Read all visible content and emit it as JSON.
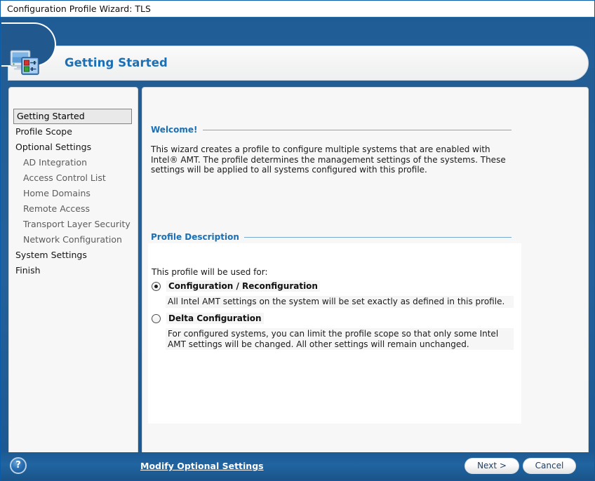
{
  "window": {
    "title": "Configuration Profile Wizard: TLS"
  },
  "header": {
    "icon": "amt-configuration-icon",
    "title": "Getting Started"
  },
  "sidebar": {
    "items": [
      {
        "label": "Getting Started",
        "level": "top",
        "state": "current"
      },
      {
        "label": "Profile Scope",
        "level": "top",
        "state": "normal"
      },
      {
        "label": "Optional Settings",
        "level": "top",
        "state": "normal"
      },
      {
        "label": "AD Integration",
        "level": "sub",
        "state": "normal"
      },
      {
        "label": "Access Control List",
        "level": "sub",
        "state": "normal"
      },
      {
        "label": "Home Domains",
        "level": "sub",
        "state": "normal"
      },
      {
        "label": "Remote Access",
        "level": "sub",
        "state": "normal"
      },
      {
        "label": "Transport Layer Security",
        "level": "sub",
        "state": "normal"
      },
      {
        "label": "Network Configuration",
        "level": "sub",
        "state": "normal"
      },
      {
        "label": "System Settings",
        "level": "top",
        "state": "normal"
      },
      {
        "label": "Finish",
        "level": "top",
        "state": "normal"
      }
    ]
  },
  "main": {
    "welcome": {
      "heading": "Welcome!",
      "body": "This wizard creates a profile to configure multiple systems that are enabled with Intel® AMT. The profile determines the management settings of the systems. These settings will be applied to all systems configured with this profile."
    },
    "profile_description": {
      "heading": "Profile Description",
      "prompt": "This profile will be used for:",
      "options": [
        {
          "label": "Configuration / Reconfiguration",
          "description": "All Intel AMT settings on the system will be set exactly as defined in this profile.",
          "selected": true
        },
        {
          "label": "Delta Configuration",
          "description": "For configured systems, you can limit the profile scope so that only some Intel AMT settings will be changed. All other settings will remain unchanged.",
          "selected": false
        }
      ]
    }
  },
  "footer": {
    "help_icon": "help-question-icon",
    "help_glyph": "?",
    "modify_link": "Modify Optional Settings",
    "next_label": "Next >",
    "cancel_label": "Cancel"
  },
  "colors": {
    "chrome_blue": "#21599a",
    "accent_blue": "#1a6fb5",
    "panel_bg": "#f7f7f7",
    "card_bg": "#ffffff"
  }
}
